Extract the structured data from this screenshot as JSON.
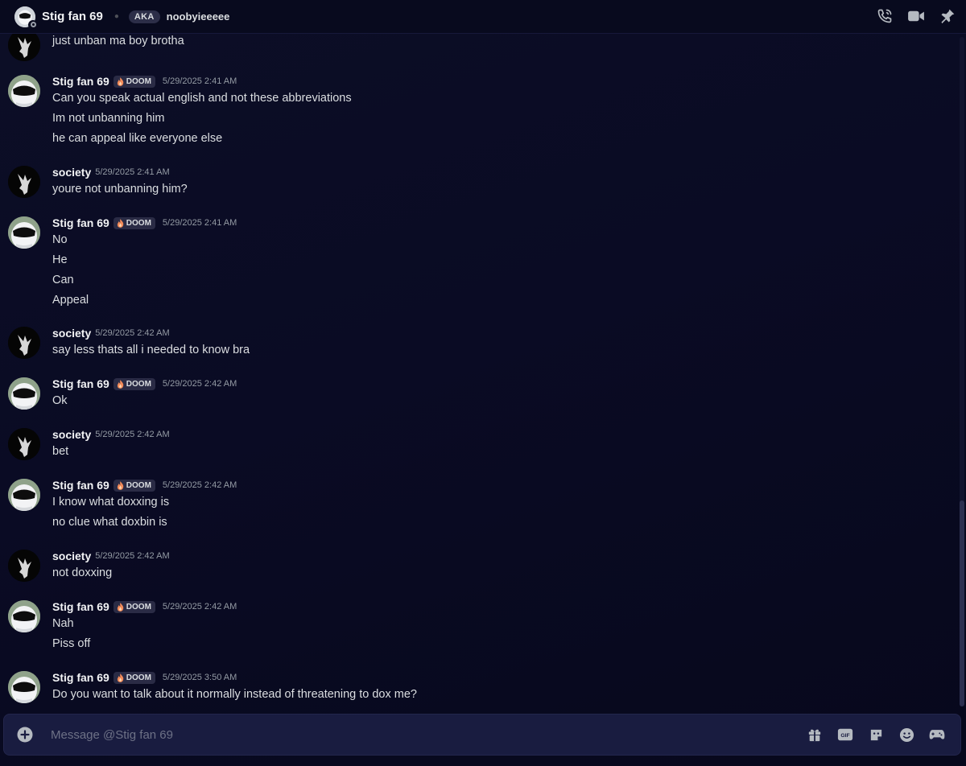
{
  "header": {
    "title": "Stig fan 69",
    "aka_label": "AKA",
    "aka_name": "noobyieeeee",
    "icons": [
      "phone-call-icon",
      "video-call-icon",
      "pin-icon"
    ]
  },
  "users": {
    "stig": {
      "name": "Stig fan 69",
      "tag": "DOOM"
    },
    "society": {
      "name": "society"
    }
  },
  "messages": [
    {
      "author": "",
      "time": "",
      "lines": [
        "just unban ma boy brotha"
      ]
    },
    {
      "author": "Stig fan 69",
      "tag": "DOOM",
      "time": "5/29/2025 2:41 AM",
      "lines": [
        "Can you speak actual english and not these abbreviations",
        "Im not unbanning him",
        "he can appeal like everyone else"
      ]
    },
    {
      "author": "society",
      "time": "5/29/2025 2:41 AM",
      "lines": [
        "youre not unbanning him?"
      ]
    },
    {
      "author": "Stig fan 69",
      "tag": "DOOM",
      "time": "5/29/2025 2:41 AM",
      "lines": [
        "No",
        "He",
        "Can",
        "Appeal"
      ]
    },
    {
      "author": "society",
      "time": "5/29/2025 2:42 AM",
      "lines": [
        "say less thats all i needed to know bra"
      ]
    },
    {
      "author": "Stig fan 69",
      "tag": "DOOM",
      "time": "5/29/2025 2:42 AM",
      "lines": [
        "Ok"
      ]
    },
    {
      "author": "society",
      "time": "5/29/2025 2:42 AM",
      "lines": [
        "bet"
      ]
    },
    {
      "author": "Stig fan 69",
      "tag": "DOOM",
      "time": "5/29/2025 2:42 AM",
      "lines": [
        "I know what doxxing is",
        "no clue what doxbin is"
      ]
    },
    {
      "author": "society",
      "time": "5/29/2025 2:42 AM",
      "lines": [
        "not doxxing"
      ]
    },
    {
      "author": "Stig fan 69",
      "tag": "DOOM",
      "time": "5/29/2025 2:42 AM",
      "lines": [
        "Nah",
        "Piss off"
      ]
    },
    {
      "author": "Stig fan 69",
      "tag": "DOOM",
      "time": "5/29/2025 3:50 AM",
      "lines": [
        "Do you want to talk about it normally instead of threatening to dox me?"
      ]
    }
  ],
  "composer": {
    "placeholder": "Message @Stig fan 69",
    "gif_label": "GIF",
    "icons": [
      "add-attachment-icon",
      "gift-icon",
      "gif-icon",
      "sticker-icon",
      "emoji-icon",
      "apps-icon"
    ]
  },
  "colors": {
    "background": "#0a0b24",
    "header": "#080a1e",
    "composer": "#191c40",
    "timestamp": "#949ba4"
  }
}
